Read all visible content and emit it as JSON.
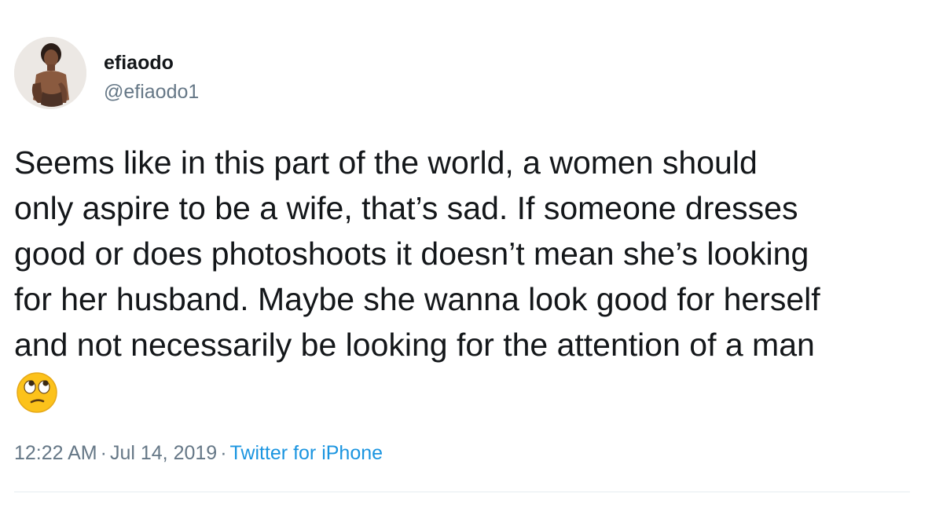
{
  "author": {
    "display_name": "efiaodo",
    "handle": "@efiaodo1"
  },
  "tweet": {
    "lines": [
      "Seems like in this part of the world, a women should",
      "only aspire to be a wife, that’s sad. If someone dresses",
      "good or does photoshoots it doesn’t mean she’s looking",
      "for her husband. Maybe she wanna look good for herself",
      "and not necessarily be looking for the attention of a man"
    ],
    "emoji": "face-with-rolling-eyes"
  },
  "meta": {
    "time": "12:22 AM",
    "separator": "·",
    "date": "Jul 14, 2019",
    "source": "Twitter for iPhone"
  },
  "colors": {
    "text": "#14171a",
    "secondary": "#657786",
    "link": "#1b95e0",
    "divider": "#e6ecf0"
  }
}
